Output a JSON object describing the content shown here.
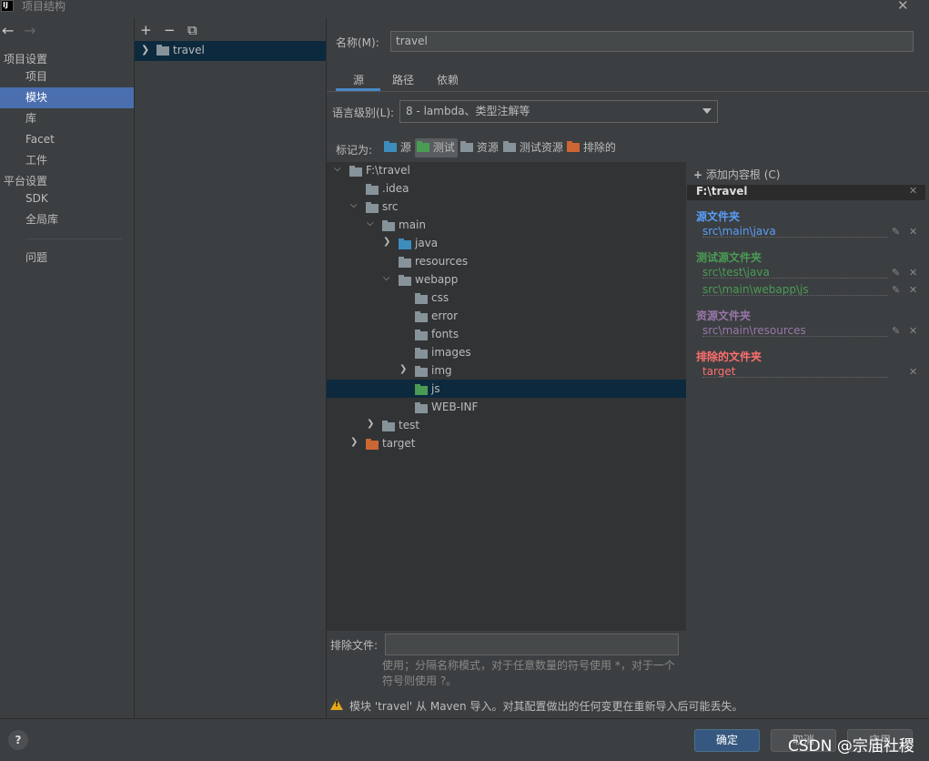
{
  "window": {
    "title": "项目结构",
    "app_icon": "IJ"
  },
  "colors": {
    "source": "#4a88c7",
    "test": "#499c54",
    "resource": "#9876aa",
    "excluded": "#cc6633",
    "selection": "#4b6eaf"
  },
  "nav": {
    "project_settings": "项目设置",
    "items1": [
      "项目",
      "模块",
      "库",
      "Facet",
      "工件"
    ],
    "platform_settings": "平台设置",
    "items2": [
      "SDK",
      "全局库"
    ],
    "problems": "问题"
  },
  "modules": {
    "toolbar": [
      "+",
      "−",
      "⧉"
    ],
    "items": [
      "travel"
    ]
  },
  "module": {
    "name_label": "名称(M):",
    "name_value": "travel",
    "tabs": [
      "源",
      "路径",
      "依赖"
    ],
    "lang_label": "语言级别(L):",
    "lang_value": "8 - lambda、类型注解等",
    "mark_as_label": "标记为:",
    "mark_as": [
      "源",
      "测试",
      "资源",
      "测试资源",
      "排除的"
    ]
  },
  "tree": [
    {
      "label": "F:\\travel",
      "depth": 0,
      "expanded": true,
      "icon": "plain"
    },
    {
      "label": ".idea",
      "depth": 1,
      "icon": "plain"
    },
    {
      "label": "src",
      "depth": 1,
      "expanded": true,
      "icon": "plain"
    },
    {
      "label": "main",
      "depth": 2,
      "expanded": true,
      "icon": "plain"
    },
    {
      "label": "java",
      "depth": 3,
      "expanded": false,
      "icon": "source"
    },
    {
      "label": "resources",
      "depth": 3,
      "icon": "resource"
    },
    {
      "label": "webapp",
      "depth": 3,
      "expanded": true,
      "icon": "plain"
    },
    {
      "label": "css",
      "depth": 4,
      "icon": "plain"
    },
    {
      "label": "error",
      "depth": 4,
      "icon": "plain"
    },
    {
      "label": "fonts",
      "depth": 4,
      "icon": "plain"
    },
    {
      "label": "images",
      "depth": 4,
      "icon": "plain"
    },
    {
      "label": "img",
      "depth": 4,
      "expanded": false,
      "icon": "plain"
    },
    {
      "label": "js",
      "depth": 4,
      "icon": "test",
      "selected": true
    },
    {
      "label": "WEB-INF",
      "depth": 4,
      "icon": "plain"
    },
    {
      "label": "test",
      "depth": 2,
      "expanded": false,
      "icon": "plain"
    },
    {
      "label": "target",
      "depth": 1,
      "expanded": false,
      "icon": "excluded"
    }
  ],
  "content_root": {
    "add_label": "添加内容根 (C)",
    "root": "F:\\travel",
    "sections": [
      {
        "title": "源文件夹",
        "color": "#589df6",
        "paths": [
          "src\\main\\java"
        ]
      },
      {
        "title": "测试源文件夹",
        "color": "#499c54",
        "paths": [
          "src\\test\\java",
          "src\\main\\webapp\\js"
        ]
      },
      {
        "title": "资源文件夹",
        "color": "#9876aa",
        "paths": [
          "src\\main\\resources"
        ]
      },
      {
        "title": "排除的文件夹",
        "color": "#ff6e6e",
        "paths": [
          "target"
        ]
      }
    ]
  },
  "exclude": {
    "label": "排除文件:",
    "help": "使用；分隔名称模式，对于任意数量的符号使用 *，对于一个符号则使用 ?。"
  },
  "warning": "模块 'travel' 从 Maven 导入。对其配置做出的任何变更在重新导入后可能丢失。",
  "buttons": {
    "ok": "确定",
    "cancel": "取消",
    "apply": "应用",
    "help": "?"
  },
  "watermark": "CSDN @宗庙社稷"
}
